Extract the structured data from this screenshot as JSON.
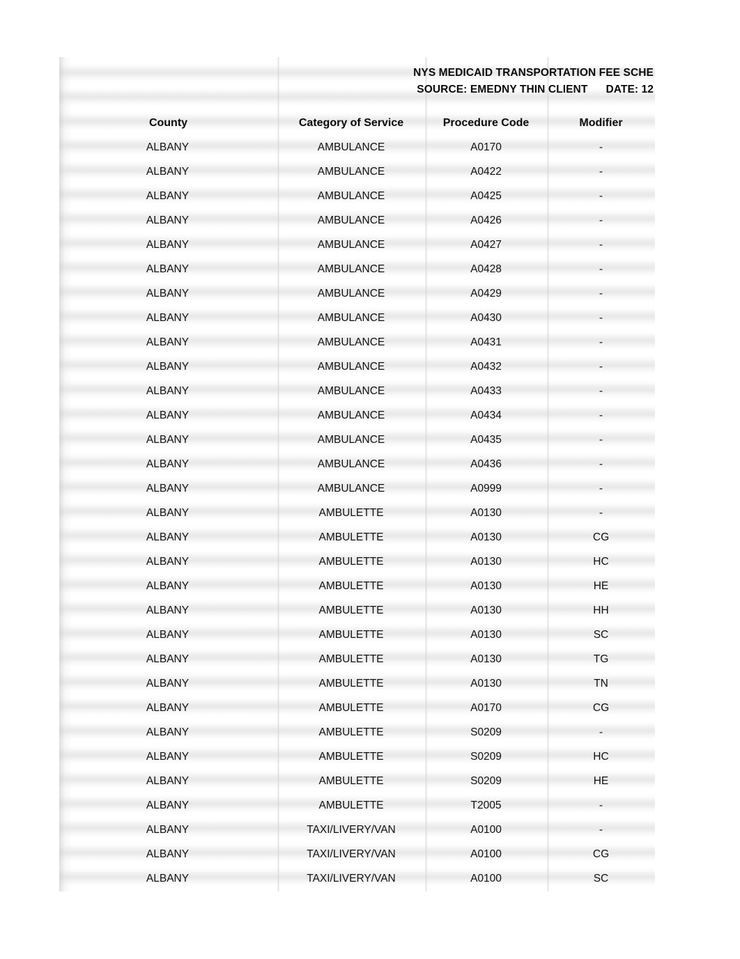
{
  "document": {
    "title_line1": "NYS MEDICAID TRANSPORTATION FEE SCHE",
    "title_line2_source": "SOURCE: EMEDNY THIN CLIENT",
    "title_line2_date": "DATE: 12"
  },
  "table": {
    "columns": [
      {
        "key": "county",
        "label": "County"
      },
      {
        "key": "category",
        "label": "Category of Service"
      },
      {
        "key": "procedure",
        "label": "Procedure Code"
      },
      {
        "key": "modifier",
        "label": "Modifier"
      }
    ],
    "rows": [
      {
        "county": "ALBANY",
        "category": "AMBULANCE",
        "procedure": "A0170",
        "modifier": "-"
      },
      {
        "county": "ALBANY",
        "category": "AMBULANCE",
        "procedure": "A0422",
        "modifier": "-"
      },
      {
        "county": "ALBANY",
        "category": "AMBULANCE",
        "procedure": "A0425",
        "modifier": "-"
      },
      {
        "county": "ALBANY",
        "category": "AMBULANCE",
        "procedure": "A0426",
        "modifier": "-"
      },
      {
        "county": "ALBANY",
        "category": "AMBULANCE",
        "procedure": "A0427",
        "modifier": "-"
      },
      {
        "county": "ALBANY",
        "category": "AMBULANCE",
        "procedure": "A0428",
        "modifier": "-"
      },
      {
        "county": "ALBANY",
        "category": "AMBULANCE",
        "procedure": "A0429",
        "modifier": "-"
      },
      {
        "county": "ALBANY",
        "category": "AMBULANCE",
        "procedure": "A0430",
        "modifier": "-"
      },
      {
        "county": "ALBANY",
        "category": "AMBULANCE",
        "procedure": "A0431",
        "modifier": "-"
      },
      {
        "county": "ALBANY",
        "category": "AMBULANCE",
        "procedure": "A0432",
        "modifier": "-"
      },
      {
        "county": "ALBANY",
        "category": "AMBULANCE",
        "procedure": "A0433",
        "modifier": "-"
      },
      {
        "county": "ALBANY",
        "category": "AMBULANCE",
        "procedure": "A0434",
        "modifier": "-"
      },
      {
        "county": "ALBANY",
        "category": "AMBULANCE",
        "procedure": "A0435",
        "modifier": "-"
      },
      {
        "county": "ALBANY",
        "category": "AMBULANCE",
        "procedure": "A0436",
        "modifier": "-"
      },
      {
        "county": "ALBANY",
        "category": "AMBULANCE",
        "procedure": "A0999",
        "modifier": "-"
      },
      {
        "county": "ALBANY",
        "category": "AMBULETTE",
        "procedure": "A0130",
        "modifier": "-"
      },
      {
        "county": "ALBANY",
        "category": "AMBULETTE",
        "procedure": "A0130",
        "modifier": "CG"
      },
      {
        "county": "ALBANY",
        "category": "AMBULETTE",
        "procedure": "A0130",
        "modifier": "HC"
      },
      {
        "county": "ALBANY",
        "category": "AMBULETTE",
        "procedure": "A0130",
        "modifier": "HE"
      },
      {
        "county": "ALBANY",
        "category": "AMBULETTE",
        "procedure": "A0130",
        "modifier": "HH"
      },
      {
        "county": "ALBANY",
        "category": "AMBULETTE",
        "procedure": "A0130",
        "modifier": "SC"
      },
      {
        "county": "ALBANY",
        "category": "AMBULETTE",
        "procedure": "A0130",
        "modifier": "TG"
      },
      {
        "county": "ALBANY",
        "category": "AMBULETTE",
        "procedure": "A0130",
        "modifier": "TN"
      },
      {
        "county": "ALBANY",
        "category": "AMBULETTE",
        "procedure": "A0170",
        "modifier": "CG"
      },
      {
        "county": "ALBANY",
        "category": "AMBULETTE",
        "procedure": "S0209",
        "modifier": "-"
      },
      {
        "county": "ALBANY",
        "category": "AMBULETTE",
        "procedure": "S0209",
        "modifier": "HC"
      },
      {
        "county": "ALBANY",
        "category": "AMBULETTE",
        "procedure": "S0209",
        "modifier": "HE"
      },
      {
        "county": "ALBANY",
        "category": "AMBULETTE",
        "procedure": "T2005",
        "modifier": "-"
      },
      {
        "county": "ALBANY",
        "category": "TAXI/LIVERY/VAN",
        "procedure": "A0100",
        "modifier": "-"
      },
      {
        "county": "ALBANY",
        "category": "TAXI/LIVERY/VAN",
        "procedure": "A0100",
        "modifier": "CG"
      },
      {
        "county": "ALBANY",
        "category": "TAXI/LIVERY/VAN",
        "procedure": "A0100",
        "modifier": "SC"
      }
    ]
  }
}
